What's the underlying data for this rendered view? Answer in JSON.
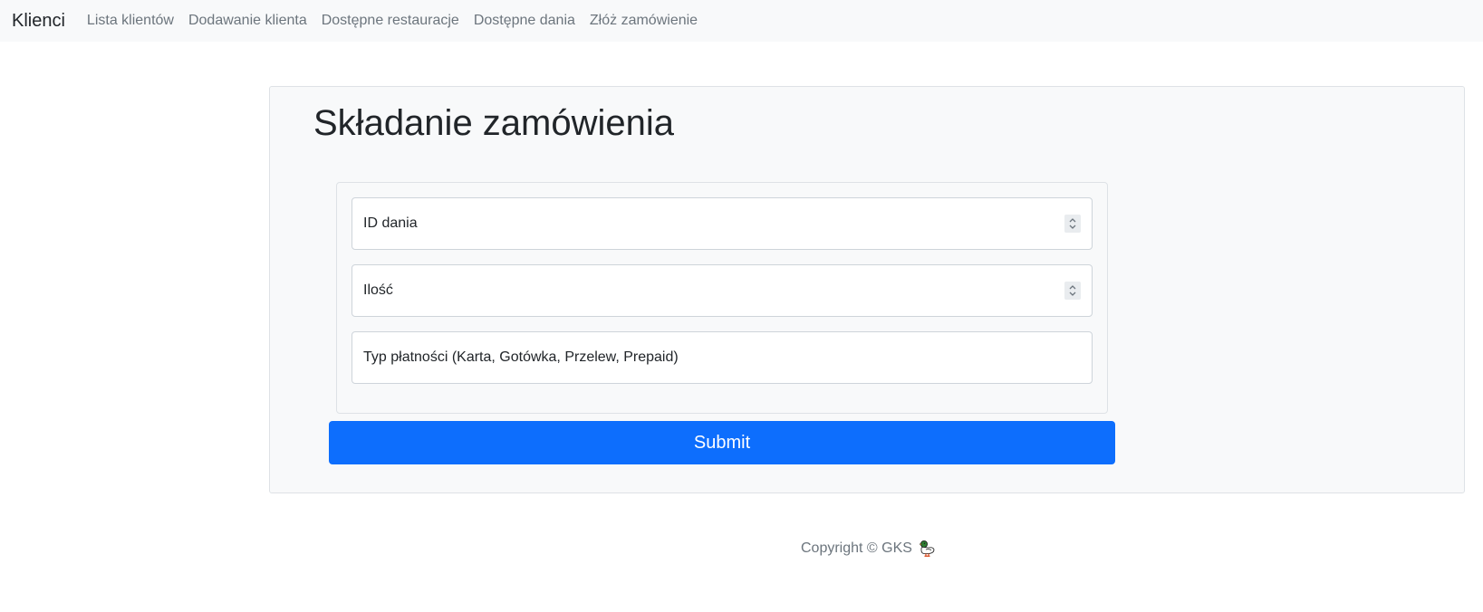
{
  "navbar": {
    "brand": "Klienci",
    "links": [
      "Lista klientów",
      "Dodawanie klienta",
      "Dostępne restauracje",
      "Dostępne dania",
      "Złóż zamówienie"
    ]
  },
  "page": {
    "title": "Składanie zamówienia"
  },
  "form": {
    "dish_id_placeholder": "ID dania",
    "quantity_placeholder": "Ilość",
    "payment_type_placeholder": "Typ płatności (Karta, Gotówka, Przelew, Prepaid)",
    "submit_label": "Submit"
  },
  "footer": {
    "copyright": "Copyright © GKS"
  },
  "colors": {
    "primary": "#0d6efd",
    "navbar_bg": "#f8f9fa",
    "muted_text": "#6c757d"
  },
  "icons": {
    "number_spinner": "up-down-chevron-icon",
    "footer_logo": "duck-icon"
  }
}
